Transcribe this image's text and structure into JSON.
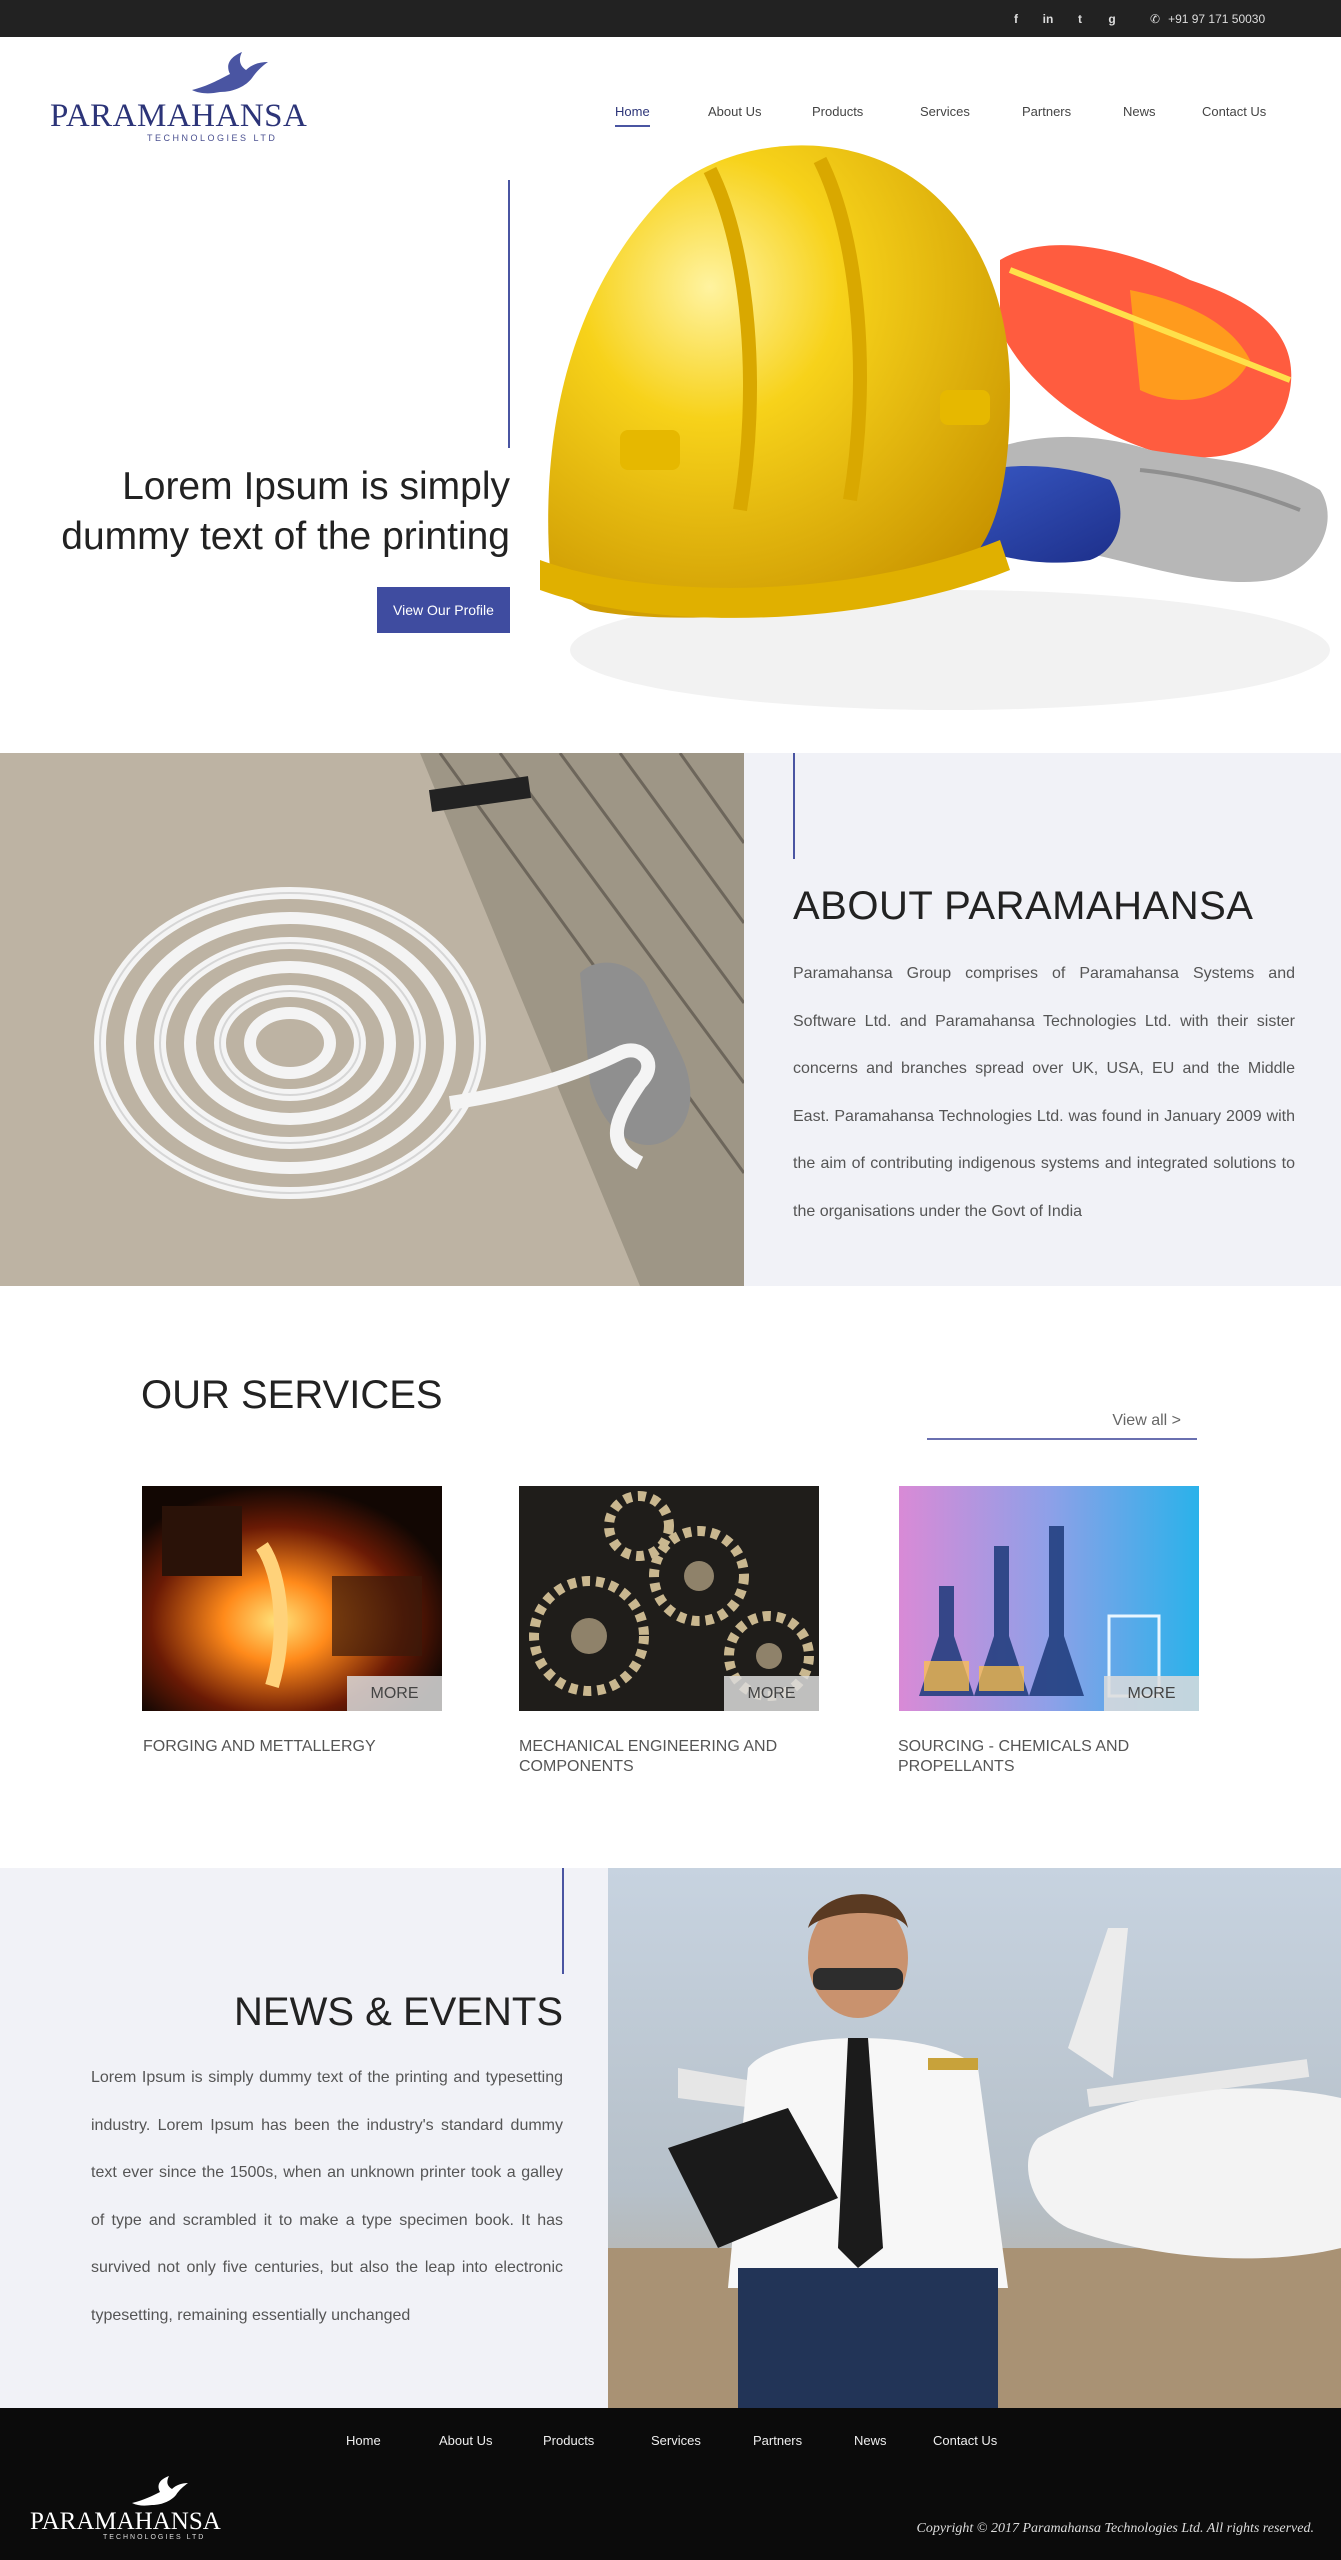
{
  "topbar": {
    "social": [
      {
        "icon": "facebook-icon",
        "glyph": "f"
      },
      {
        "icon": "linkedin-icon",
        "glyph": "in"
      },
      {
        "icon": "twitter-icon",
        "glyph": "t"
      },
      {
        "icon": "google-plus-icon",
        "glyph": "g"
      }
    ],
    "phone": "+91 97 171 50030"
  },
  "logo": {
    "brand": "PARAMAHANSA",
    "sub": "TECHNOLOGIES LTD"
  },
  "nav": [
    "Home",
    "About Us",
    "Products",
    "Services",
    "Partners",
    "News",
    "Contact Us"
  ],
  "hero": {
    "title_line1": "Lorem Ipsum is simply",
    "title_line2": "dummy text of the printing",
    "button": "View Our Profile"
  },
  "about": {
    "title": "ABOUT PARAMAHANSA",
    "text": "Paramahansa Group comprises of Paramahansa Systems and Software Ltd. and Paramahansa Technologies Ltd. with their sister concerns and branches spread over UK, USA, EU and the Middle East. Paramahansa Technologies Ltd. was found in January 2009 with the aim of contributing indigenous systems and integrated solutions to the organisations under the Govt of India"
  },
  "services": {
    "title": "OUR SERVICES",
    "view_all": "View all  >",
    "more": "MORE",
    "items": [
      {
        "label": "FORGING AND METTALLERGY"
      },
      {
        "label": "MECHANICAL ENGINEERING AND COMPONENTS"
      },
      {
        "label": "SOURCING - CHEMICALS AND PROPELLANTS"
      }
    ]
  },
  "news": {
    "title": "NEWS & EVENTS",
    "text": "Lorem Ipsum is simply dummy text of the printing and typesetting industry. Lorem Ipsum has been the industry's standard dummy text ever since the 1500s, when an unknown printer took a galley of type and scrambled it to make a type specimen book. It has survived not only five centuries, but also the leap into electronic typesetting, remaining essentially unchanged"
  },
  "footer": {
    "nav": [
      "Home",
      "About Us",
      "Products",
      "Services",
      "Partners",
      "News",
      "Contact Us"
    ],
    "copyright": "Copyright © 2017 Paramahansa Technologies Ltd. All rights reserved."
  },
  "colors": {
    "accent": "#3f4ca0",
    "brand": "#2c3478",
    "panel": "#f1f2f7",
    "topbar": "#222222",
    "footer": "#0b0b0b"
  }
}
